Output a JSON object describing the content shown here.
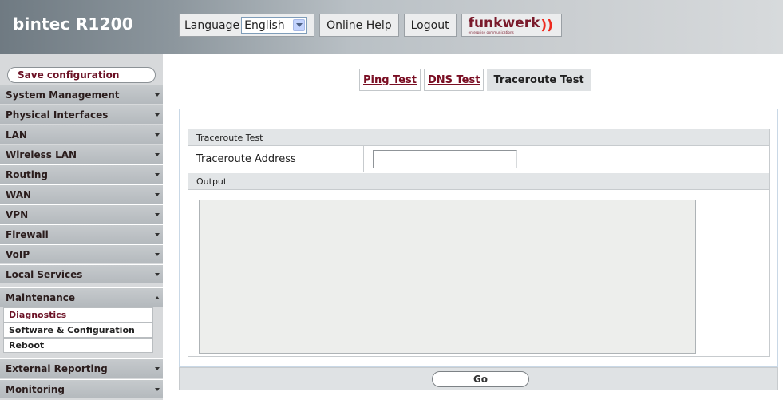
{
  "header": {
    "brand": "bintec R1200",
    "language_label": "Language",
    "language_selected": "English",
    "online_help": "Online Help",
    "logout": "Logout",
    "logo_text": "funkwerk",
    "logo_waves": "))",
    "logo_sub": "enterprise communications"
  },
  "sidebar": {
    "save_label": "Save configuration",
    "menu": [
      {
        "label": "System Management",
        "expanded": false
      },
      {
        "label": "Physical Interfaces",
        "expanded": false
      },
      {
        "label": "LAN",
        "expanded": false
      },
      {
        "label": "Wireless LAN",
        "expanded": false
      },
      {
        "label": "Routing",
        "expanded": false
      },
      {
        "label": "WAN",
        "expanded": false
      },
      {
        "label": "VPN",
        "expanded": false
      },
      {
        "label": "Firewall",
        "expanded": false
      },
      {
        "label": "VoIP",
        "expanded": false
      },
      {
        "label": "Local Services",
        "expanded": false
      },
      {
        "label": "Maintenance",
        "expanded": true
      },
      {
        "label": "External Reporting",
        "expanded": false
      },
      {
        "label": "Monitoring",
        "expanded": false
      }
    ],
    "maintenance_sub": [
      {
        "label": "Diagnostics",
        "active": true
      },
      {
        "label": "Software & Configuration",
        "active": false
      },
      {
        "label": "Reboot",
        "active": false
      }
    ]
  },
  "tabs": [
    {
      "label": "Ping Test",
      "current": false
    },
    {
      "label": "DNS Test",
      "current": false
    },
    {
      "label": "Traceroute Test",
      "current": true
    }
  ],
  "form": {
    "section_title": "Traceroute Test",
    "address_label": "Traceroute Address",
    "address_value": "",
    "output_title": "Output",
    "output_value": ""
  },
  "actions": {
    "go_label": "Go"
  },
  "colors": {
    "accent": "#6b1024",
    "link": "#7a0e23",
    "logo_red": "#ee2a1f"
  }
}
